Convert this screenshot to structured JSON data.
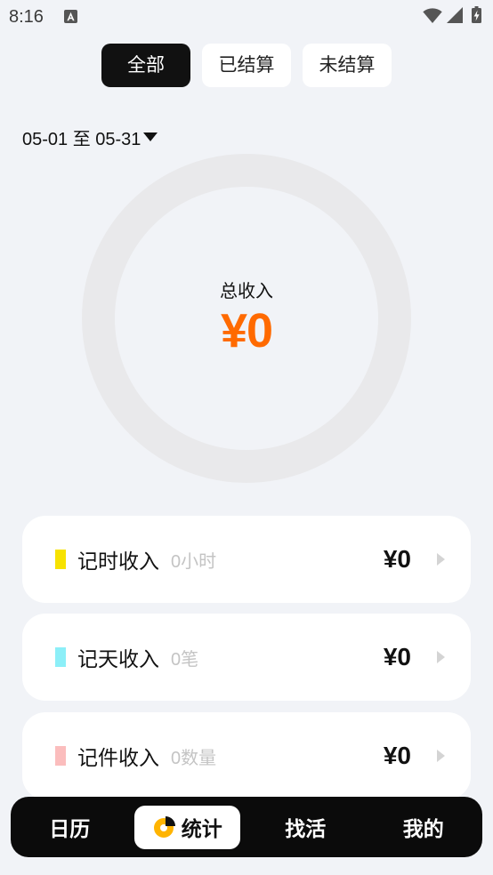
{
  "status_bar": {
    "time": "8:16",
    "icons": [
      "a-notification-icon",
      "wifi-icon",
      "signal-icon",
      "battery-charging-icon"
    ]
  },
  "filter_tabs": [
    {
      "label": "全部",
      "selected": true
    },
    {
      "label": "已结算",
      "selected": false
    },
    {
      "label": "未结算",
      "selected": false
    }
  ],
  "date_range": {
    "label": "05-01 至 05-31",
    "icon": "caret-down-icon"
  },
  "summary": {
    "title": "总收入",
    "amount": "¥0",
    "amount_color": "#ff6a00",
    "ring_color": "#e9e9eb"
  },
  "income_items": [
    {
      "label": "记时收入",
      "detail": "0小时",
      "amount": "¥0",
      "color": "#f7e200",
      "icon": "chevron-right-icon"
    },
    {
      "label": "记天收入",
      "detail": "0笔",
      "amount": "¥0",
      "color": "#8ceff8",
      "icon": "chevron-right-icon"
    },
    {
      "label": "记件收入",
      "detail": "0数量",
      "amount": "¥0",
      "color": "#fbbdbd",
      "icon": "chevron-right-icon"
    }
  ],
  "bottom_nav": [
    {
      "label": "日历",
      "selected": false
    },
    {
      "label": "统计",
      "selected": true,
      "icon": "pie-chart-icon"
    },
    {
      "label": "找活",
      "selected": false
    },
    {
      "label": "我的",
      "selected": false
    }
  ],
  "colors": {
    "background": "#f1f3f7",
    "primary_dark": "#111111",
    "accent_orange": "#ff6a00",
    "nav_icon_yellow": "#ffb400"
  }
}
